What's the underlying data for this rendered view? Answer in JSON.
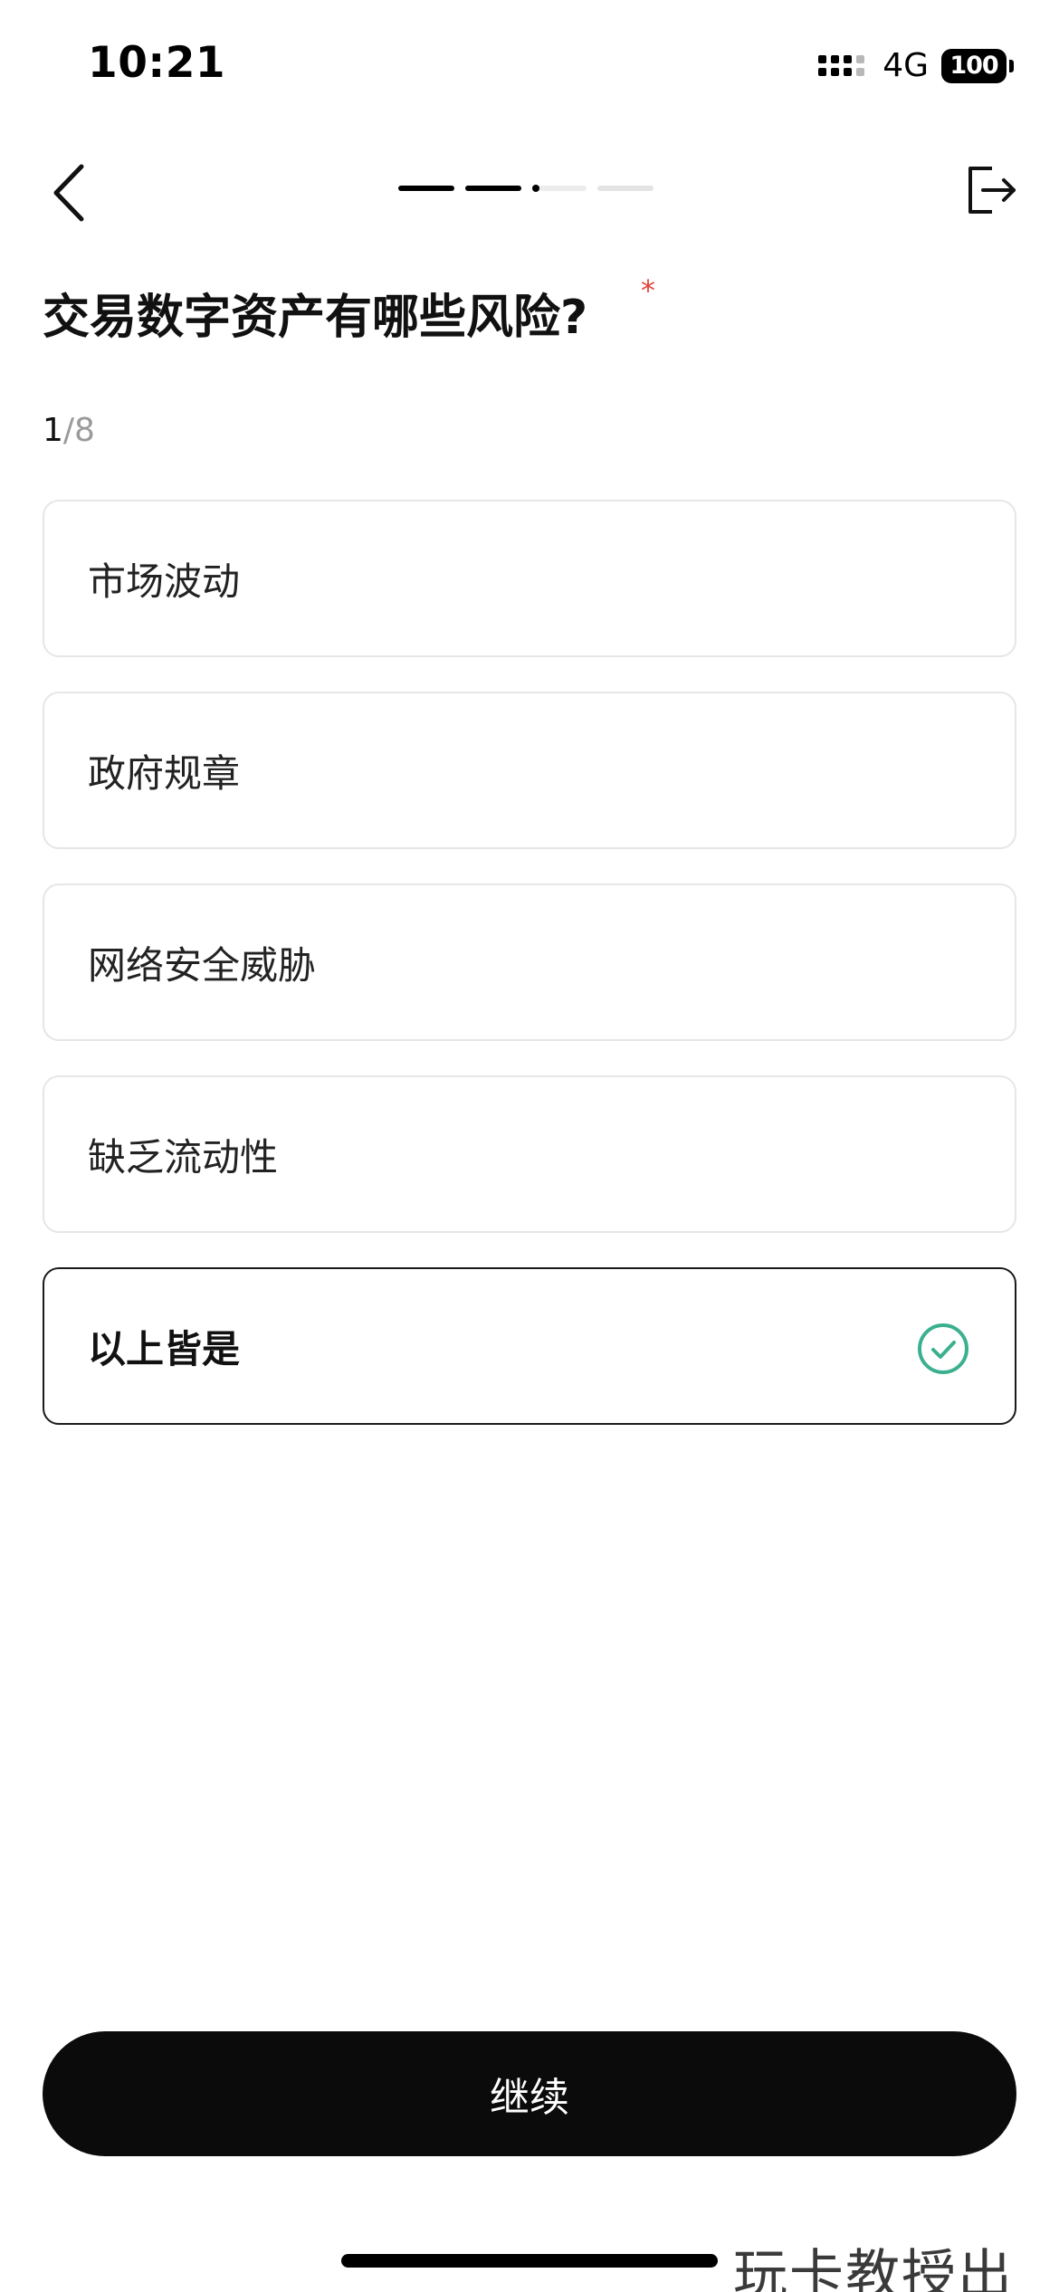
{
  "status_bar": {
    "time": "10:21",
    "network": "4G",
    "battery": "100"
  },
  "nav": {
    "back_icon": "chevron-left-icon",
    "exit_icon": "exit-icon",
    "progress": {
      "total_steps": 4,
      "completed_steps": 2,
      "current_step": 3
    }
  },
  "question": {
    "title": "交易数字资产有哪些风险?",
    "required_mark": "*",
    "counter_current": "1",
    "counter_total": "/8"
  },
  "options": [
    {
      "label": "市场波动",
      "selected": false
    },
    {
      "label": "政府规章",
      "selected": false
    },
    {
      "label": "网络安全威胁",
      "selected": false
    },
    {
      "label": "缺乏流动性",
      "selected": false
    },
    {
      "label": "以上皆是",
      "selected": true,
      "icon": "check-circle-icon"
    }
  ],
  "continue_button": {
    "label": "继续"
  },
  "watermark": "玩卡教授出品",
  "colors": {
    "primary": "#0b0b0b",
    "check": "#3bb08f",
    "required": "#e0453d",
    "option_border": "#e6e6e6"
  }
}
